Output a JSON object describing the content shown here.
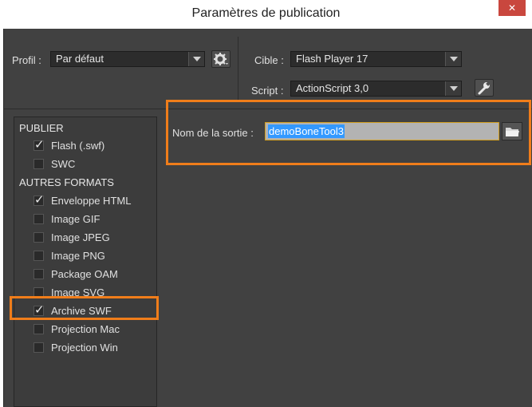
{
  "window": {
    "title": "Paramètres de publication",
    "close_label": "✕"
  },
  "profile": {
    "label": "Profil :",
    "value": "Par défaut"
  },
  "target": {
    "label": "Cible :",
    "value": "Flash Player 17"
  },
  "script": {
    "label": "Script :",
    "value": "ActionScript 3,0"
  },
  "output": {
    "label": "Nom de la sortie :",
    "value": "demoBoneTool3"
  },
  "sections": {
    "publish": "PUBLIER",
    "other_formats": "AUTRES FORMATS"
  },
  "publish_items": [
    {
      "label": "Flash (.swf)",
      "checked": true
    },
    {
      "label": "SWC",
      "checked": false
    }
  ],
  "format_items": [
    {
      "label": "Enveloppe HTML",
      "checked": true
    },
    {
      "label": "Image GIF",
      "checked": false
    },
    {
      "label": "Image JPEG",
      "checked": false
    },
    {
      "label": "Image PNG",
      "checked": false
    },
    {
      "label": "Package OAM",
      "checked": false
    },
    {
      "label": "Image SVG",
      "checked": false
    },
    {
      "label": "Archive SWF",
      "checked": true
    },
    {
      "label": "Projection Mac",
      "checked": false
    },
    {
      "label": "Projection Win",
      "checked": false
    }
  ],
  "colors": {
    "accent_highlight": "#f07d1a",
    "selection": "#3399ff",
    "panel": "#414141"
  }
}
